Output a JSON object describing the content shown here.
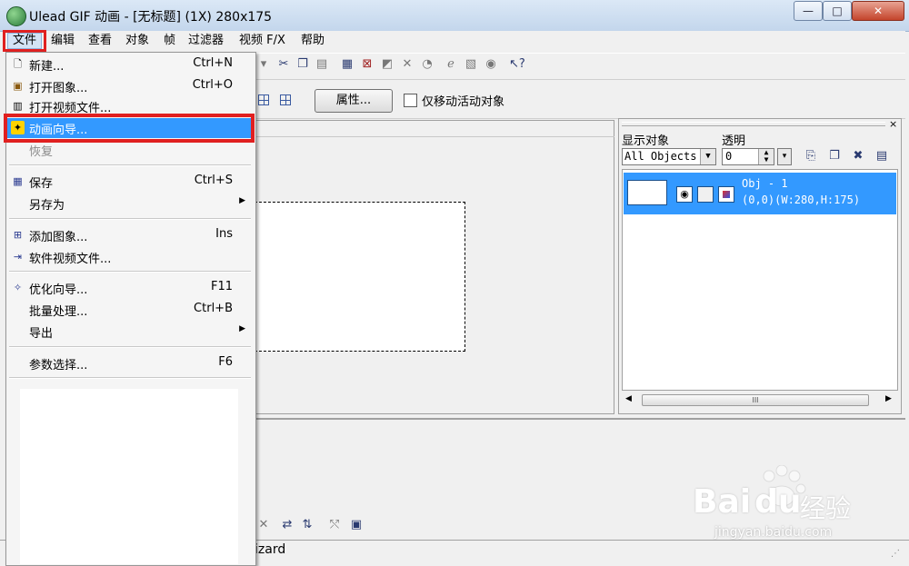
{
  "window": {
    "title": "Ulead GIF 动画 - [无标题] (1X) 280x175",
    "minimize_label": "—",
    "maximize_label": "□",
    "close_label": "✕"
  },
  "menubar": {
    "items": [
      "文件",
      "编辑",
      "查看",
      "对象",
      "帧",
      "过滤器",
      "视频 F/X",
      "帮助"
    ]
  },
  "toolbar2": {
    "properties_label": "属性...",
    "move_active_only_label": "仅移动活动对象",
    "move_active_only_checked": false
  },
  "object_panel": {
    "display_label": "显示对象",
    "transparency_label": "透明",
    "display_select": "All Objects",
    "transparency_value": "0",
    "object": {
      "name": "Obj - 1",
      "info": "(0,0)(W:280,H:175)"
    },
    "scroll_grip": "III"
  },
  "status": {
    "text": "izard"
  },
  "file_menu": {
    "new": {
      "label": "新建...",
      "shortcut": "Ctrl+N"
    },
    "open_image": {
      "label": "打开图象...",
      "shortcut": "Ctrl+O"
    },
    "open_video": {
      "label": "打开视频文件..."
    },
    "animation_wizard": {
      "label": "动画向导..."
    },
    "revert": {
      "label": "恢复"
    },
    "save": {
      "label": "保存",
      "shortcut": "Ctrl+S"
    },
    "save_as": {
      "label": "另存为"
    },
    "add_image": {
      "label": "添加图象...",
      "shortcut": "Ins"
    },
    "software_video": {
      "label": "软件视频文件..."
    },
    "optimize_wizard": {
      "label": "优化向导...",
      "shortcut": "F11"
    },
    "batch": {
      "label": "批量处理...",
      "shortcut": "Ctrl+B"
    },
    "export": {
      "label": "导出"
    },
    "preferences": {
      "label": "参数选择...",
      "shortcut": "F6"
    }
  },
  "watermark": {
    "brand": "Bai",
    "brand2": "du",
    "cn": "经验",
    "url": "jingyan.baidu.com"
  }
}
